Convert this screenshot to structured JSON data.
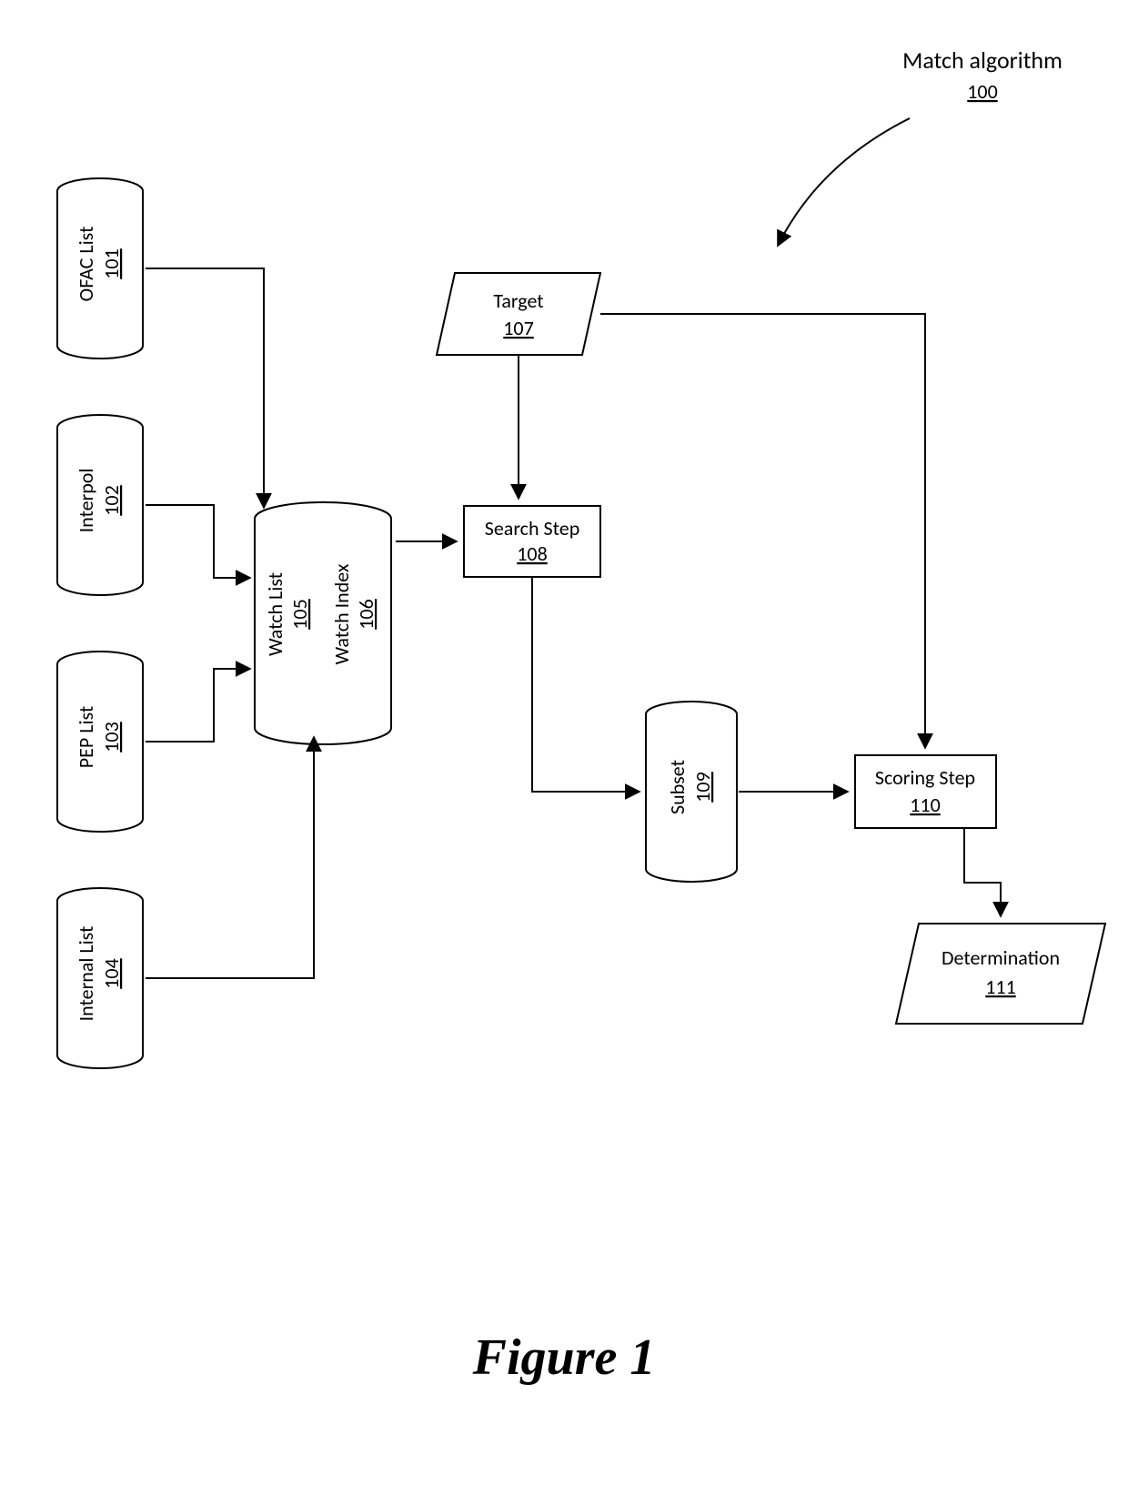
{
  "title": {
    "text": "Match algorithm",
    "ref": "100"
  },
  "sources": [
    {
      "label": "OFAC List",
      "ref": "101"
    },
    {
      "label": "Interpol",
      "ref": "102"
    },
    {
      "label": "PEP List",
      "ref": "103"
    },
    {
      "label": "Internal List",
      "ref": "104"
    }
  ],
  "watchlist": {
    "label1": "Watch List",
    "ref1": "105",
    "label2": "Watch Index",
    "ref2": "106"
  },
  "target": {
    "label": "Target",
    "ref": "107"
  },
  "search": {
    "label": "Search Step",
    "ref": "108"
  },
  "subset": {
    "label": "Subset",
    "ref": "109"
  },
  "scoring": {
    "label": "Scoring Step",
    "ref": "110"
  },
  "determination": {
    "label": "Determination",
    "ref": "111"
  },
  "figure": "Figure 1"
}
